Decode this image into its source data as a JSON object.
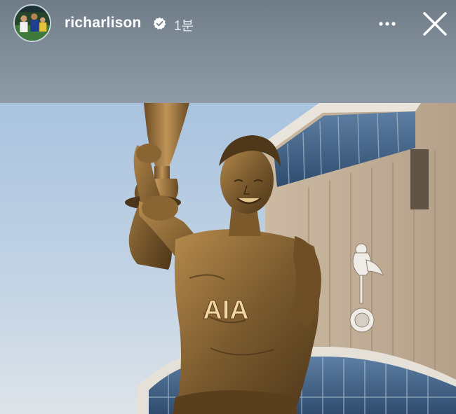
{
  "story": {
    "username": "richarlison",
    "timestamp": "1분",
    "verified": true,
    "icons": {
      "verified": "verified-badge-icon",
      "more": "more-options-icon",
      "close": "close-icon"
    }
  },
  "photo": {
    "jersey_text": "AIA"
  },
  "colors": {
    "header_bg": "#7f8c98",
    "text": "#ffffff",
    "bronze": "#8a6a3a",
    "sky": "#b9cde3"
  }
}
